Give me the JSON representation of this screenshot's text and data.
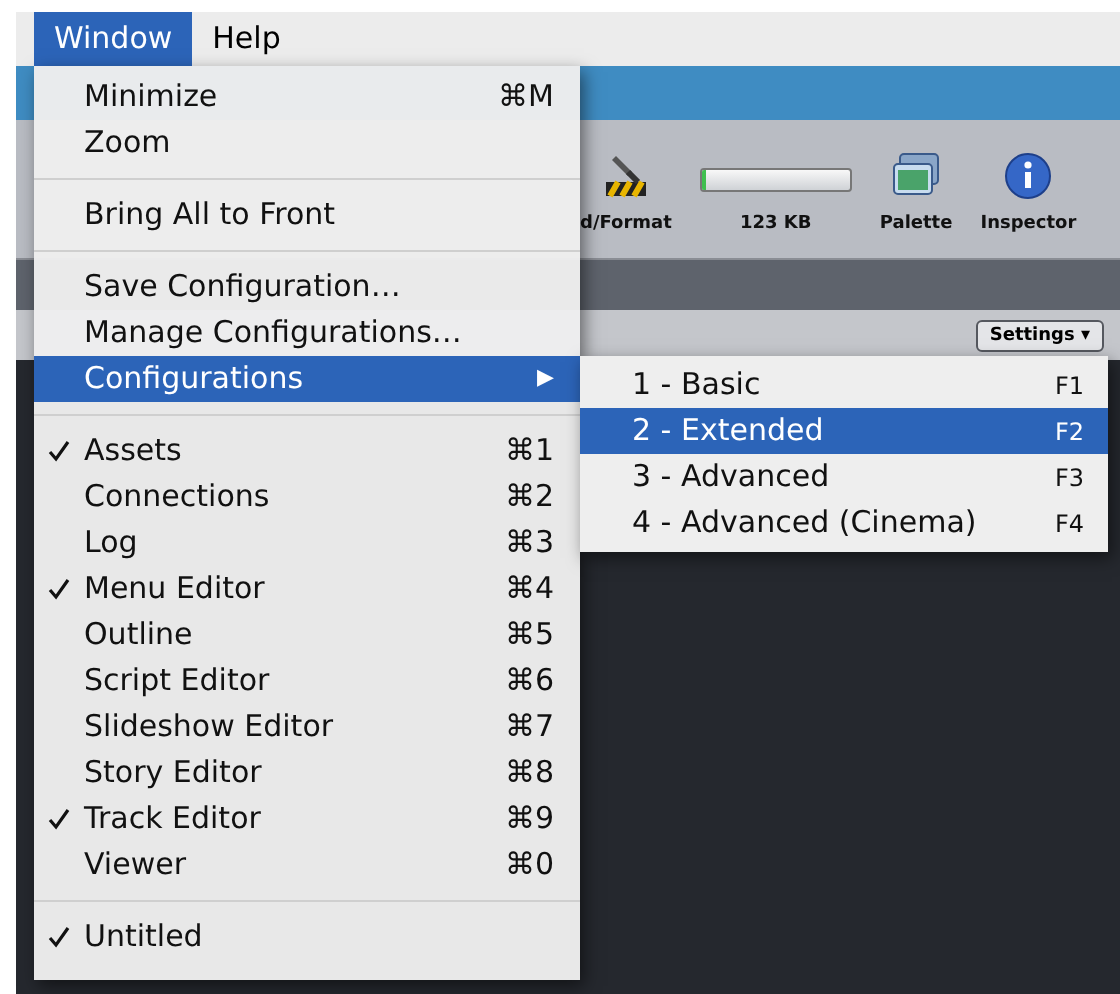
{
  "menubar": [
    {
      "label": "Window",
      "selected": true
    },
    {
      "label": "Help",
      "selected": false
    }
  ],
  "toolbar": {
    "items": [
      {
        "kind": "hammer",
        "label": "d/Format"
      },
      {
        "kind": "meter",
        "label": "123 KB",
        "level": 0.03
      },
      {
        "kind": "palette",
        "label": "Palette"
      },
      {
        "kind": "info",
        "label": "Inspector"
      }
    ],
    "settings_button": "Settings ▾"
  },
  "menu": {
    "items": [
      {
        "kind": "item",
        "label": "Minimize",
        "shortcut": "⌘M",
        "checked": false,
        "selected": false
      },
      {
        "kind": "item",
        "label": "Zoom",
        "checked": false,
        "selected": false
      },
      {
        "kind": "separator"
      },
      {
        "kind": "item",
        "label": "Bring All to Front",
        "checked": false,
        "selected": false
      },
      {
        "kind": "separator"
      },
      {
        "kind": "item",
        "label": "Save Configuration…",
        "checked": false,
        "selected": false
      },
      {
        "kind": "item",
        "label": "Manage Configurations…",
        "checked": false,
        "selected": false
      },
      {
        "kind": "submenu",
        "label": "Configurations",
        "arrow": "▶",
        "checked": false,
        "selected": true
      },
      {
        "kind": "separator"
      },
      {
        "kind": "item",
        "label": "Assets",
        "shortcut": "⌘1",
        "checked": true,
        "selected": false
      },
      {
        "kind": "item",
        "label": "Connections",
        "shortcut": "⌘2",
        "checked": false,
        "selected": false
      },
      {
        "kind": "item",
        "label": "Log",
        "shortcut": "⌘3",
        "checked": false,
        "selected": false
      },
      {
        "kind": "item",
        "label": "Menu Editor",
        "shortcut": "⌘4",
        "checked": true,
        "selected": false
      },
      {
        "kind": "item",
        "label": "Outline",
        "shortcut": "⌘5",
        "checked": false,
        "selected": false
      },
      {
        "kind": "item",
        "label": "Script Editor",
        "shortcut": "⌘6",
        "checked": false,
        "selected": false
      },
      {
        "kind": "item",
        "label": "Slideshow Editor",
        "shortcut": "⌘7",
        "checked": false,
        "selected": false
      },
      {
        "kind": "item",
        "label": "Story Editor",
        "shortcut": "⌘8",
        "checked": false,
        "selected": false
      },
      {
        "kind": "item",
        "label": "Track Editor",
        "shortcut": "⌘9",
        "checked": true,
        "selected": false
      },
      {
        "kind": "item",
        "label": "Viewer",
        "shortcut": "⌘0",
        "checked": false,
        "selected": false
      },
      {
        "kind": "separator"
      },
      {
        "kind": "item",
        "label": "Untitled",
        "checked": true,
        "selected": false
      }
    ]
  },
  "submenu": {
    "items": [
      {
        "label": "1 - Basic",
        "shortcut": "F1",
        "selected": false
      },
      {
        "label": "2 - Extended",
        "shortcut": "F2",
        "selected": true
      },
      {
        "label": "3 - Advanced",
        "shortcut": "F3",
        "selected": false
      },
      {
        "label": "4 - Advanced (Cinema)",
        "shortcut": "F4",
        "selected": false
      }
    ]
  }
}
